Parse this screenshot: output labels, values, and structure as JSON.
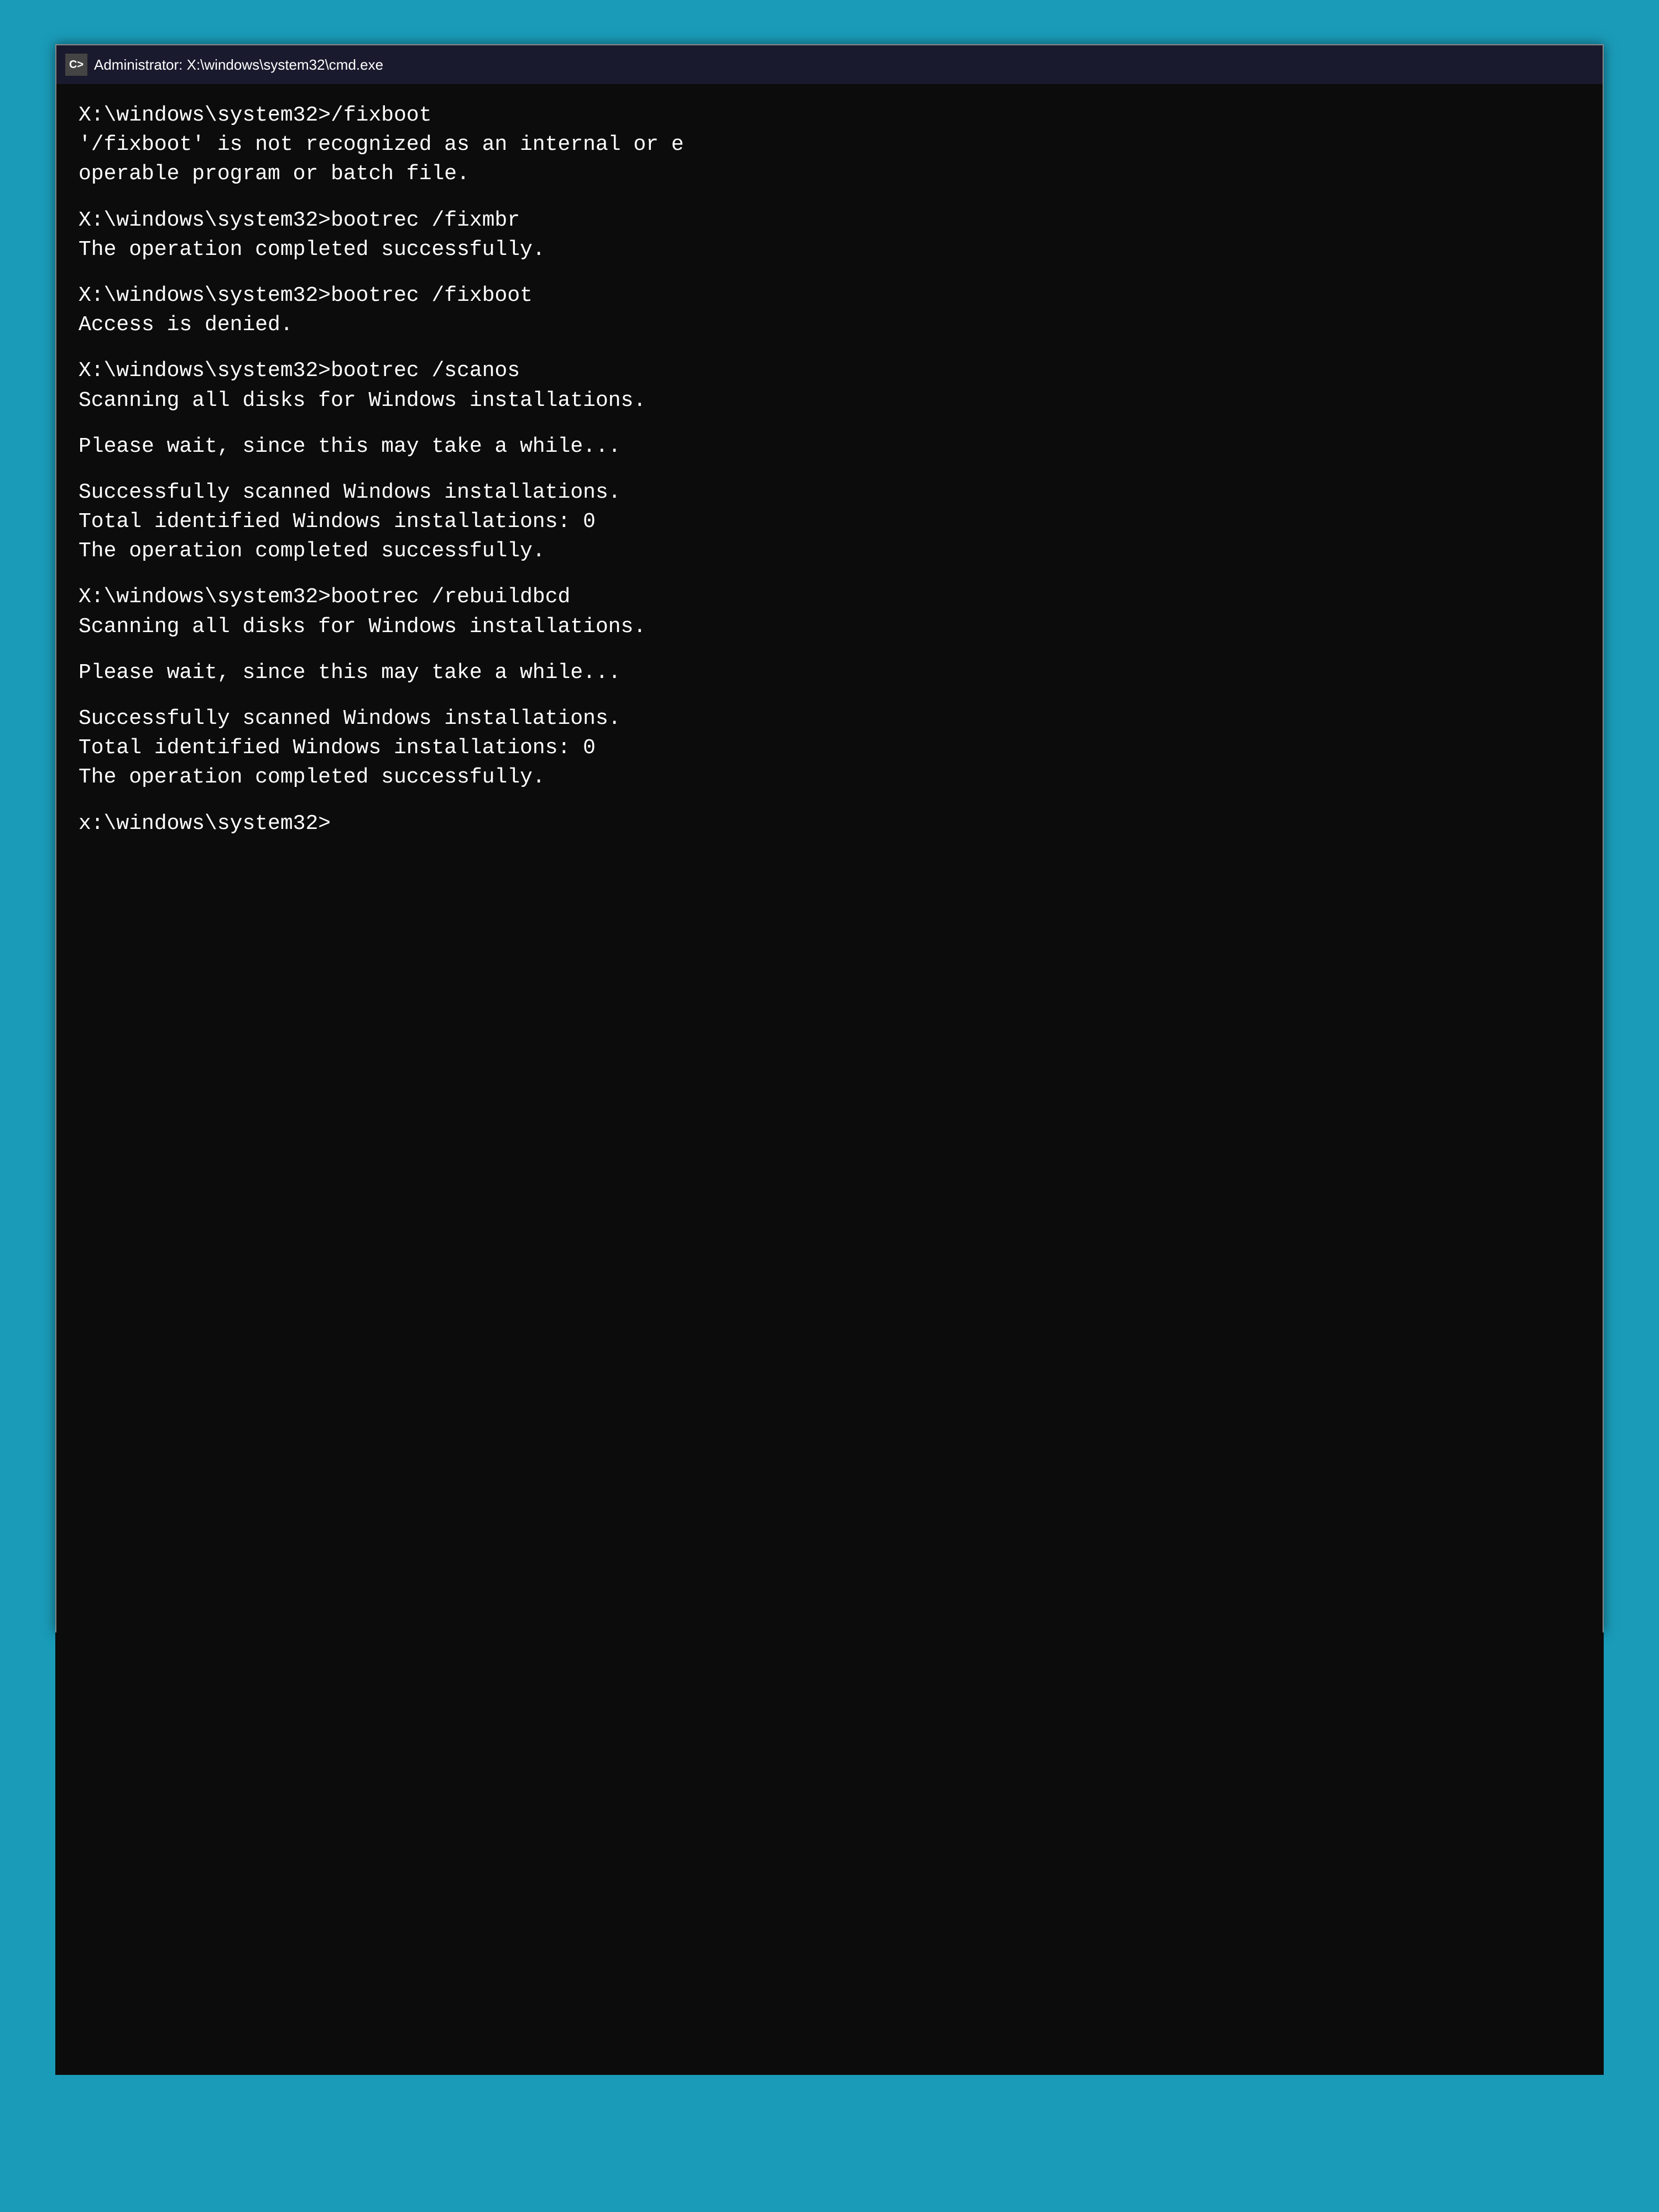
{
  "titleBar": {
    "icon": "CMD",
    "title": "Administrator: X:\\windows\\system32\\cmd.exe"
  },
  "terminal": {
    "lines": [
      {
        "type": "prompt",
        "text": "X:\\windows\\system32>/fixboot"
      },
      {
        "type": "error",
        "text": "'/fixboot' is not recognized as an internal or e"
      },
      {
        "type": "error",
        "text": "operable program or batch file."
      },
      {
        "type": "spacer"
      },
      {
        "type": "prompt",
        "text": "X:\\windows\\system32>bootrec /fixmbr"
      },
      {
        "type": "output",
        "text": "The operation completed successfully."
      },
      {
        "type": "spacer"
      },
      {
        "type": "prompt",
        "text": "X:\\windows\\system32>bootrec /fixboot"
      },
      {
        "type": "error",
        "text": "Access is denied."
      },
      {
        "type": "spacer"
      },
      {
        "type": "prompt",
        "text": "X:\\windows\\system32>bootrec /scanos"
      },
      {
        "type": "output",
        "text": "Scanning all disks for Windows installations."
      },
      {
        "type": "spacer"
      },
      {
        "type": "output",
        "text": "Please wait, since this may take a while..."
      },
      {
        "type": "spacer"
      },
      {
        "type": "success",
        "text": "Successfully scanned Windows installations."
      },
      {
        "type": "success",
        "text": "Total identified Windows installations: 0"
      },
      {
        "type": "success",
        "text": "The operation completed successfully."
      },
      {
        "type": "spacer"
      },
      {
        "type": "prompt",
        "text": "X:\\windows\\system32>bootrec /rebuildbcd"
      },
      {
        "type": "output",
        "text": "Scanning all disks for Windows installations."
      },
      {
        "type": "spacer"
      },
      {
        "type": "output",
        "text": "Please wait, since this may take a while..."
      },
      {
        "type": "spacer"
      },
      {
        "type": "success",
        "text": "Successfully scanned Windows installations."
      },
      {
        "type": "success",
        "text": "Total identified Windows installations: 0"
      },
      {
        "type": "success",
        "text": "The operation completed successfully."
      },
      {
        "type": "spacer"
      },
      {
        "type": "prompt",
        "text": "x:\\windows\\system32>"
      }
    ]
  }
}
